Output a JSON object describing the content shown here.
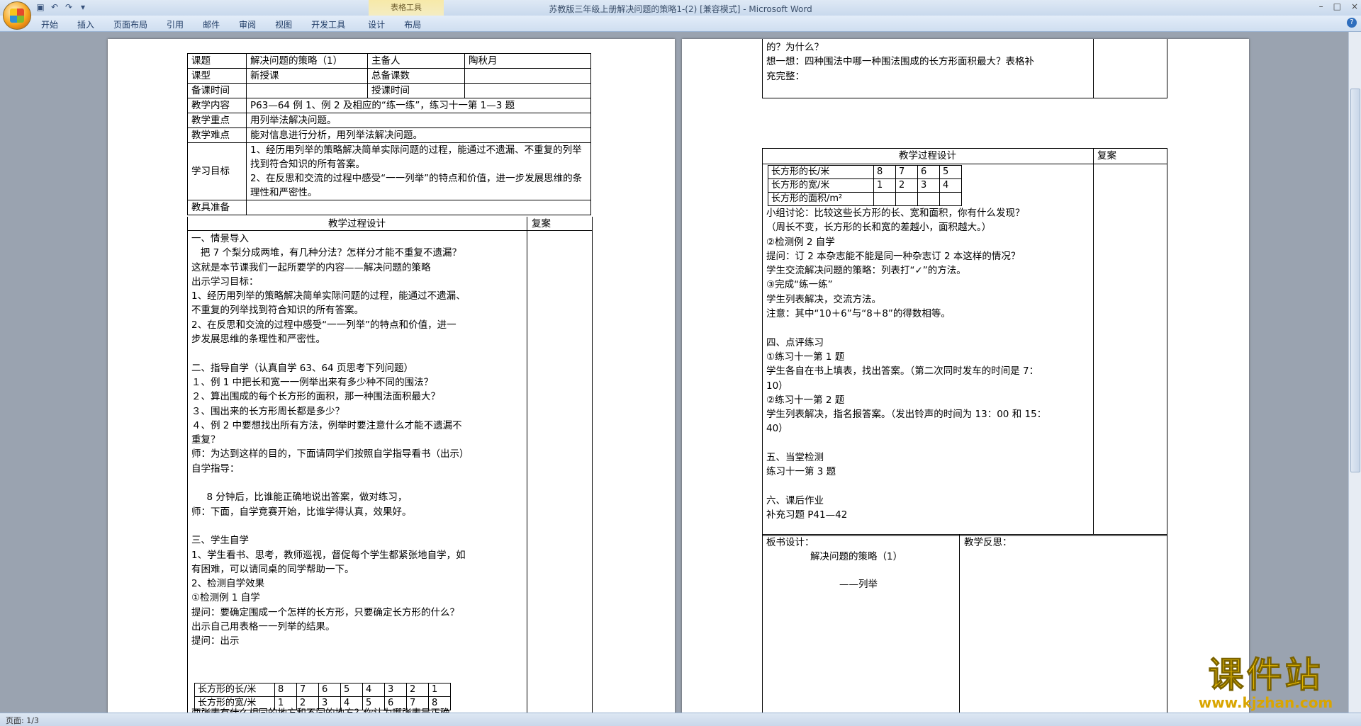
{
  "window": {
    "title": "苏教版三年级上册解决问题的策略1-(2) [兼容模式] - Microsoft Word",
    "context_tab": "表格工具",
    "controls": [
      "–",
      "□",
      "×"
    ]
  },
  "ribbon": {
    "tabs": [
      "开始",
      "插入",
      "页面布局",
      "引用",
      "邮件",
      "审阅",
      "视图",
      "开发工具",
      "设计",
      "布局"
    ]
  },
  "status": {
    "page": "页面: 1/3"
  },
  "watermark": {
    "main": "课件站",
    "url": "www.kjzhan.com"
  },
  "page1": {
    "header": {
      "topic_label": "课题",
      "topic": "解决问题的策略（1）",
      "preparer_label": "主备人",
      "preparer": "陶秋月",
      "type_label": "课型",
      "type": "新授课",
      "total_label": "总备课数",
      "time_label": "备课时间",
      "lesson_time_label": "授课时间",
      "content_label": "教学内容",
      "content": "P63—64 例 1、例 2 及相应的“练一练”，练习十一第 1—3 题",
      "focus_label": "教学重点",
      "focus": "用列举法解决问题。",
      "difficulty_label": "教学难点",
      "difficulty": "能对信息进行分析，用列举法解决问题。",
      "goal_label": "学习目标",
      "goal_1": "1、经历用列举的策略解决简单实际问题的过程，能通过不遗漏、不重复的列举找到符合知识的所有答案。",
      "goal_2": "2、在反思和交流的过程中感受“一一列举”的特点和价值，进一步发展思维的条理性和严密性。",
      "tools_label": "教具准备",
      "process_label": "教学过程设计",
      "review_label": "复案"
    },
    "body_lines": [
      "一、情景导入",
      "   把 7 个梨分成两堆，有几种分法？怎样分才能不重复不遗漏？",
      "这就是本节课我们一起所要学的内容——解决问题的策略",
      "出示学习目标：",
      "1、经历用列举的策略解决简单实际问题的过程，能通过不遗漏、",
      "不重复的列举找到符合知识的所有答案。",
      "2、在反思和交流的过程中感受“一一列举”的特点和价值，进一",
      "步发展思维的条理性和严密性。",
      "",
      "二、指导自学（认真自学 63、64 页思考下列问题）",
      "１、例 1 中把长和宽一一例举出来有多少种不同的围法？",
      "２、算出围成的每个长方形的面积，那一种围法面积最大？",
      "３、围出来的长方形周长都是多少？",
      "４、例 2 中要想找出所有方法，例举时要注意什么才能不遗漏不",
      "重复？",
      "师：为达到这样的目的，下面请同学们按照自学指导看书（出示）",
      "自学指导：",
      "",
      "     8 分钟后，比谁能正确地说出答案，做对练习，",
      "师：下面，自学竞赛开始，比谁学得认真，效果好。",
      "",
      "三、学生自学",
      "1、学生看书、思考，教师巡视，督促每个学生都紧张地自学，如",
      "有困难，可以请同桌的同学帮助一下。",
      "2、检测自学效果",
      "①检测例 1 自学",
      "提问：要确定围成一个怎样的长方形，只要确定长方形的什么？",
      "出示自己用表格一一列举的结果。",
      "提问：出示"
    ],
    "length_label": "长方形的长/米",
    "lengths": [
      "8",
      "7",
      "6",
      "5",
      "4",
      "3",
      "2",
      "1"
    ],
    "width_label": "长方形的宽/米",
    "widths": [
      "1",
      "2",
      "3",
      "4",
      "5",
      "6",
      "7",
      "8"
    ],
    "after_table": "两张表有什么相同的地方和不同的地方？你认为哪张表是正确"
  },
  "page2": {
    "top_lines": [
      "的？为什么？",
      "想一想：四种围法中哪一种围法围成的长方形面积最大？表格补",
      "充完整："
    ],
    "process_label": "教学过程设计",
    "review_label": "复案",
    "table": {
      "length_label": "长方形的长/米",
      "lengths": [
        "8",
        "7",
        "6",
        "5"
      ],
      "width_label": "长方形的宽/米",
      "widths": [
        "1",
        "2",
        "3",
        "4"
      ],
      "area_label": "长方形的面积/m²"
    },
    "body_lines": [
      "小组讨论：比较这些长方形的长、宽和面积，你有什么发现？",
      "（周长不变，长方形的长和宽的差越小，面积越大。）",
      "②检测例 2 自学",
      "提问：订 2 本杂志能不能是同一种杂志订 2 本这样的情况？",
      "学生交流解决问题的策略：列表打“✓”的方法。",
      "③完成“练一练”",
      "学生列表解决，交流方法。",
      "注意：其中“10＋6”与“8＋8”的得数相等。",
      "",
      "四、点评练习",
      "①练习十一第 1 题",
      "学生各自在书上填表，找出答案。（第二次同时发车的时间是 7：",
      "10）",
      "②练习十一第 2 题",
      "学生列表解决，指名报答案。（发出铃声的时间为 13：00 和 15：",
      "40）",
      "",
      "五、当堂检测",
      "练习十一第 3 题",
      "",
      "六、课后作业",
      "补充习题 P41—42"
    ],
    "board_label": "板书设计：",
    "board_title": "解决问题的策略（1）",
    "board_sub": "——列举",
    "reflection_label": "教学反思："
  }
}
